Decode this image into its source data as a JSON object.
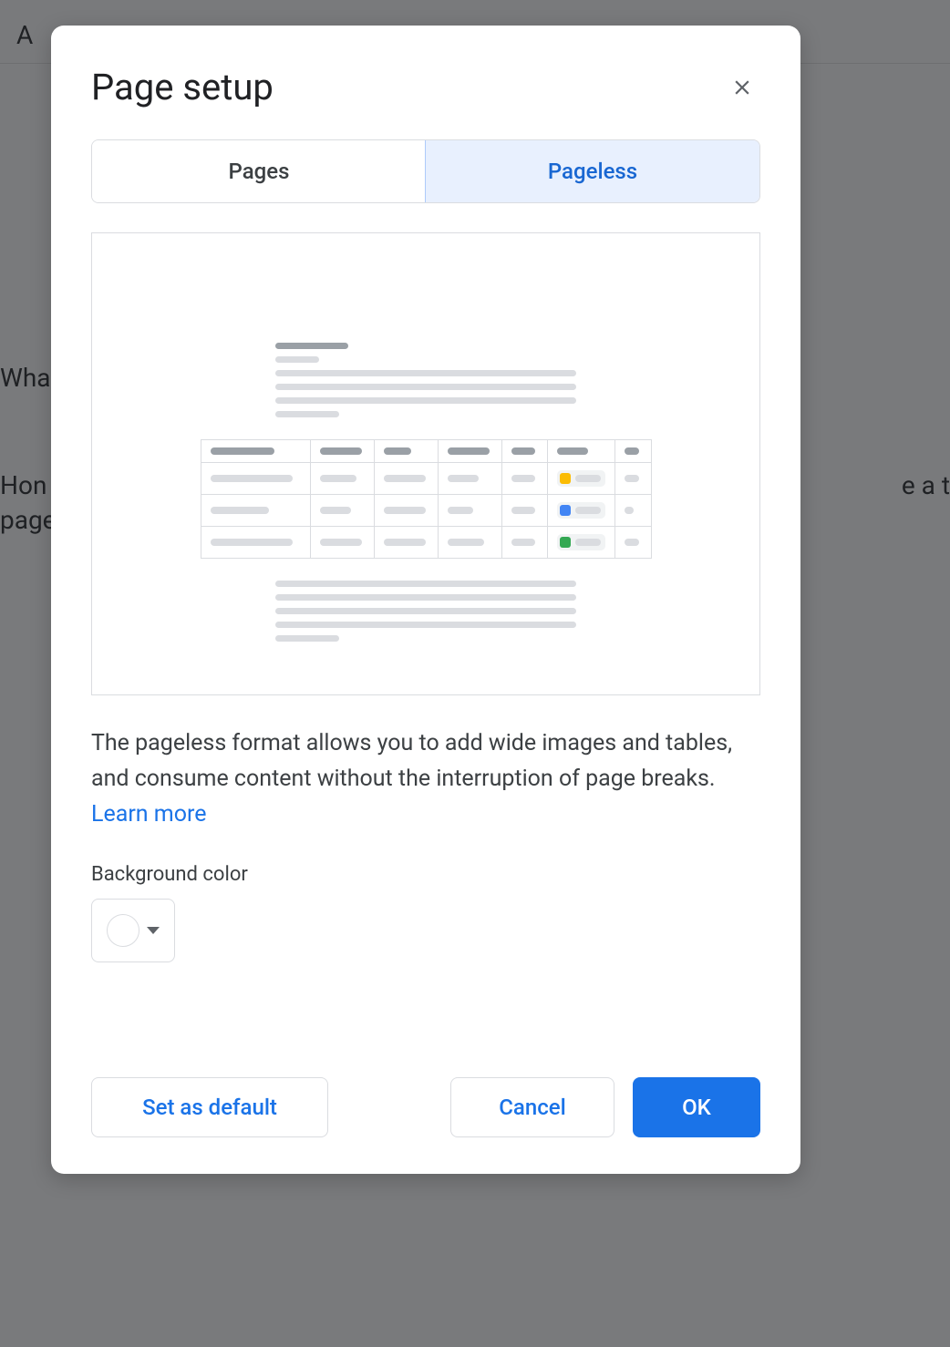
{
  "background": {
    "toolbarText": "A",
    "bodyLine1": "Wha",
    "bodyLine2": "Hon",
    "bodyLine3": "page",
    "bodyRight": "e a t"
  },
  "dialog": {
    "title": "Page setup",
    "tabs": {
      "pages": "Pages",
      "pageless": "Pageless"
    },
    "description": {
      "text": "The pageless format allows you to add wide images and tables, and consume content without the interruption of page breaks. ",
      "learnMore": "Learn more"
    },
    "bgLabel": "Background color",
    "bgColor": "#ffffff",
    "buttons": {
      "setDefault": "Set as default",
      "cancel": "Cancel",
      "ok": "OK"
    }
  }
}
